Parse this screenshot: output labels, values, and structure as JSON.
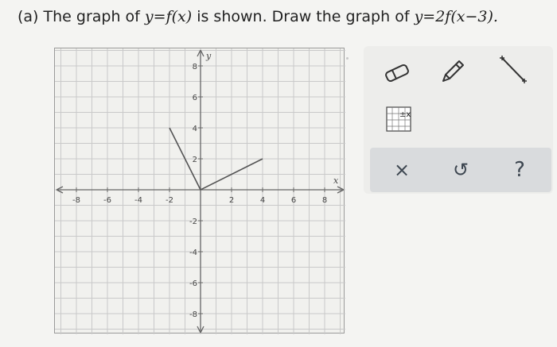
{
  "question": {
    "label": "(a)",
    "text_before": "The graph of",
    "func_given": "y=f(x)",
    "text_middle": "is shown. Draw the graph of",
    "func_target": "y=2f(x−3)."
  },
  "graph": {
    "x_axis_label": "x",
    "y_axis_label": "y",
    "x_ticks": [
      -8,
      -6,
      -4,
      -2,
      2,
      4,
      6,
      8
    ],
    "y_ticks": [
      8,
      6,
      4,
      2,
      -2,
      -4,
      -6,
      -8
    ],
    "x_range": [
      -9,
      9
    ],
    "y_range": [
      -9,
      9
    ],
    "segments": [
      {
        "from": [
          -2,
          4
        ],
        "to": [
          0,
          0
        ]
      },
      {
        "from": [
          0,
          0
        ],
        "to": [
          4,
          2
        ]
      }
    ]
  },
  "tools": {
    "eraser_icon": "eraser-icon",
    "pencil_icon": "pencil-icon",
    "line_segment_icon": "line-segment-icon",
    "graph_palette_icon": "graph-palette-icon"
  },
  "actions": {
    "clear_symbol": "×",
    "undo_symbol": "↺",
    "help_symbol": "?"
  },
  "colors": {
    "grid": "#c9c9c9",
    "axis": "#666666",
    "curve": "#555555",
    "action_icon": "#3d4650"
  }
}
